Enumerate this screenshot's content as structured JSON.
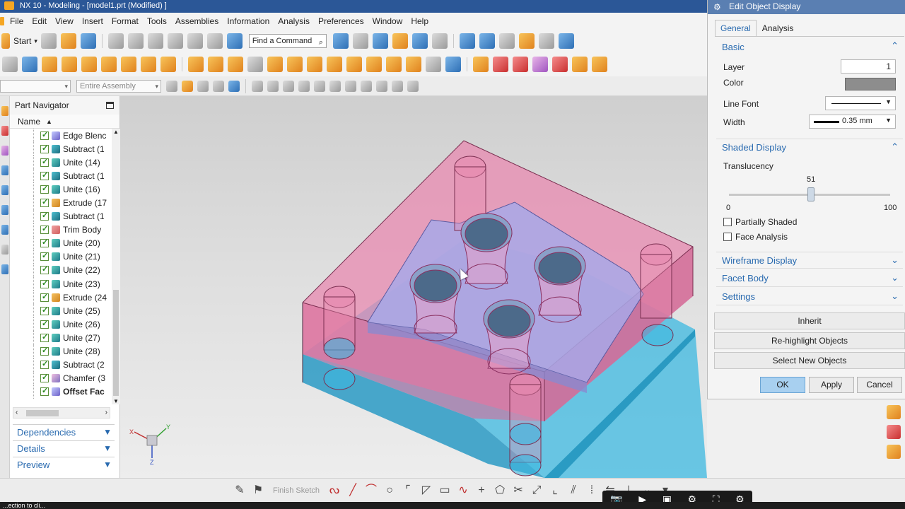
{
  "window": {
    "title": "NX 10 - Modeling - [model1.prt (Modified) ]"
  },
  "menu": [
    "File",
    "Edit",
    "View",
    "Insert",
    "Format",
    "Tools",
    "Assemblies",
    "Information",
    "Analysis",
    "Preferences",
    "Window",
    "Help"
  ],
  "toolbar": {
    "start_label": "Start",
    "find_command_placeholder": "Find a Command",
    "assembly_filter": "Entire Assembly"
  },
  "part_navigator": {
    "title": "Part Navigator",
    "column_name": "Name",
    "items": [
      {
        "label": "Edge Blenc",
        "icon": "fi-b"
      },
      {
        "label": "Subtract (1",
        "icon": "fi-s"
      },
      {
        "label": "Unite (14)",
        "icon": "fi-u"
      },
      {
        "label": "Subtract (1",
        "icon": "fi-s"
      },
      {
        "label": "Unite (16)",
        "icon": "fi-u"
      },
      {
        "label": "Extrude (17",
        "icon": "fi-e"
      },
      {
        "label": "Subtract (1",
        "icon": "fi-s"
      },
      {
        "label": "Trim Body",
        "icon": "fi-t"
      },
      {
        "label": "Unite (20)",
        "icon": "fi-u"
      },
      {
        "label": "Unite (21)",
        "icon": "fi-u"
      },
      {
        "label": "Unite (22)",
        "icon": "fi-u"
      },
      {
        "label": "Unite (23)",
        "icon": "fi-u"
      },
      {
        "label": "Extrude (24",
        "icon": "fi-e"
      },
      {
        "label": "Unite (25)",
        "icon": "fi-u"
      },
      {
        "label": "Unite (26)",
        "icon": "fi-u"
      },
      {
        "label": "Unite (27)",
        "icon": "fi-u"
      },
      {
        "label": "Unite (28)",
        "icon": "fi-u"
      },
      {
        "label": "Subtract (2",
        "icon": "fi-s"
      },
      {
        "label": "Chamfer (3",
        "icon": "fi-c"
      },
      {
        "label": "Offset Fac",
        "icon": "fi-b",
        "bold": true
      }
    ],
    "sections": {
      "dependencies": "Dependencies",
      "details": "Details",
      "preview": "Preview"
    }
  },
  "viewport": {
    "triad": {
      "x": "X",
      "y": "Y",
      "z": "Z"
    }
  },
  "bottom_toolbar": {
    "finish_sketch": "Finish Sketch"
  },
  "status_bar": {
    "text": "...ection to cli..."
  },
  "dialog": {
    "title": "Edit Object Display",
    "tabs": [
      "General",
      "Analysis"
    ],
    "basic": {
      "header": "Basic",
      "layer_label": "Layer",
      "layer_value": "1",
      "color_label": "Color",
      "color_value": "#8d8d8d",
      "line_font_label": "Line Font",
      "width_label": "Width",
      "width_value": "0.35 mm"
    },
    "shaded_display": {
      "header": "Shaded Display",
      "translucency_label": "Translucency",
      "translucency_value": "51",
      "min": "0",
      "max": "100",
      "partially_shaded": "Partially Shaded",
      "face_analysis": "Face Analysis"
    },
    "collapsed_sections": [
      "Wireframe Display",
      "Facet Body",
      "Settings"
    ],
    "buttons": {
      "inherit": "Inherit",
      "rehighlight": "Re-highlight Objects",
      "select_new": "Select New Objects",
      "ok": "OK",
      "apply": "Apply",
      "cancel": "Cancel"
    }
  },
  "colors": {
    "accent": "#2a6bb0",
    "upper_body": "#e88ab0",
    "lower_body": "#3cb8e0",
    "inner_plate": "#a8a8e8"
  }
}
